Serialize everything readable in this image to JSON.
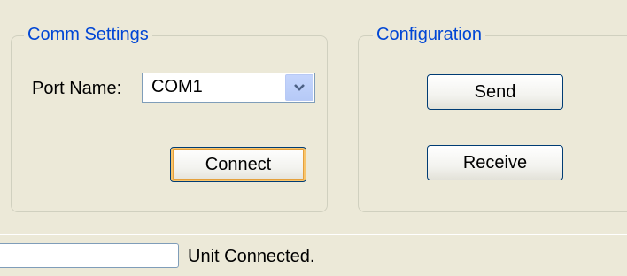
{
  "comm_settings": {
    "title": "Comm Settings",
    "port_label": "Port Name:",
    "port_value": "COM1",
    "connect_label": "Connect"
  },
  "configuration": {
    "title": "Configuration",
    "send_label": "Send",
    "receive_label": "Receive"
  },
  "status_bar": {
    "panel_value": "",
    "status_text": "Unit Connected."
  },
  "icons": {
    "combo_arrow": "chevron-down-icon"
  },
  "colors": {
    "window_bg": "#ece9d8",
    "group_title": "#0046d5",
    "button_border": "#003c74",
    "default_button_highlight": "#f8c56d"
  }
}
